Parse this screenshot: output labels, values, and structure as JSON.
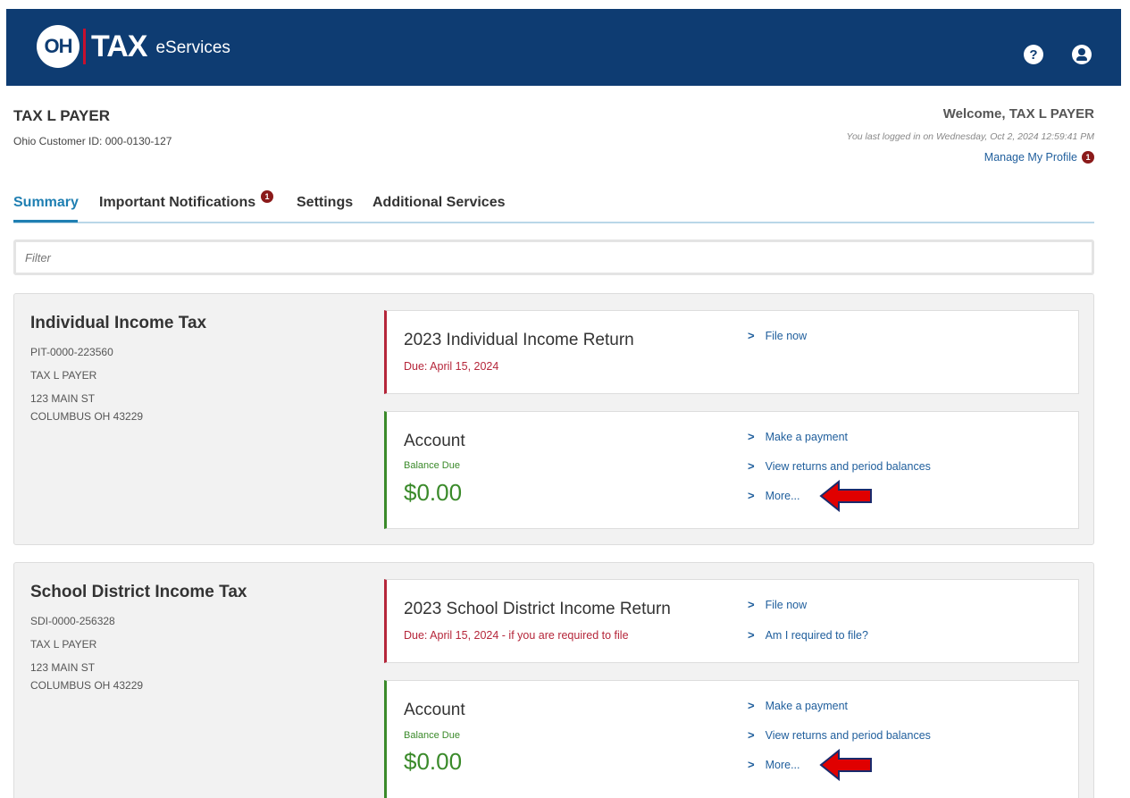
{
  "header": {
    "logo_oh": "OH",
    "logo_tax": "TAX",
    "logo_service": "eServices",
    "help_icon": "?",
    "user_icon": "user-icon"
  },
  "user": {
    "name": "TAX L PAYER",
    "customer_id": "Ohio Customer ID: 000-0130-127",
    "welcome": "Welcome, TAX L PAYER",
    "last_login": "You last logged in on Wednesday, Oct 2, 2024 12:59:41 PM",
    "manage_profile": "Manage My Profile",
    "manage_profile_badge": "1"
  },
  "tabs": [
    {
      "label": "Summary",
      "active": true
    },
    {
      "label": "Important Notifications",
      "badge": "1"
    },
    {
      "label": "Settings"
    },
    {
      "label": "Additional Services"
    }
  ],
  "filter": {
    "placeholder": "Filter"
  },
  "accounts": [
    {
      "title": "Individual Income Tax",
      "account_id": "PIT-0000-223560",
      "name": "TAX L PAYER",
      "address1": "123 MAIN ST",
      "address2": "COLUMBUS OH 43229",
      "return_title": "2023 Individual Income Return",
      "due": "Due: April 15, 2024",
      "return_links": [
        "File now"
      ],
      "account_title": "Account",
      "balance_label": "Balance Due",
      "balance": "$0.00",
      "account_links": [
        "Make a payment",
        "View returns and period balances",
        "More..."
      ]
    },
    {
      "title": "School District Income Tax",
      "account_id": "SDI-0000-256328",
      "name": "TAX L PAYER",
      "address1": "123 MAIN ST",
      "address2": "COLUMBUS OH 43229",
      "return_title": "2023 School District Income Return",
      "due": "Due: April 15, 2024 - if you are required to file",
      "return_links": [
        "File now",
        "Am I required to file?"
      ],
      "account_title": "Account",
      "balance_label": "Balance Due",
      "balance": "$0.00",
      "account_links": [
        "Make a payment",
        "View returns and period balances",
        "More..."
      ]
    }
  ],
  "colors": {
    "header_bg": "#0e3c72",
    "accent_blue": "#1f7fb2",
    "due_red": "#b5263a",
    "balance_green": "#3a8a2a",
    "annotation_arrow": "#e00000"
  }
}
